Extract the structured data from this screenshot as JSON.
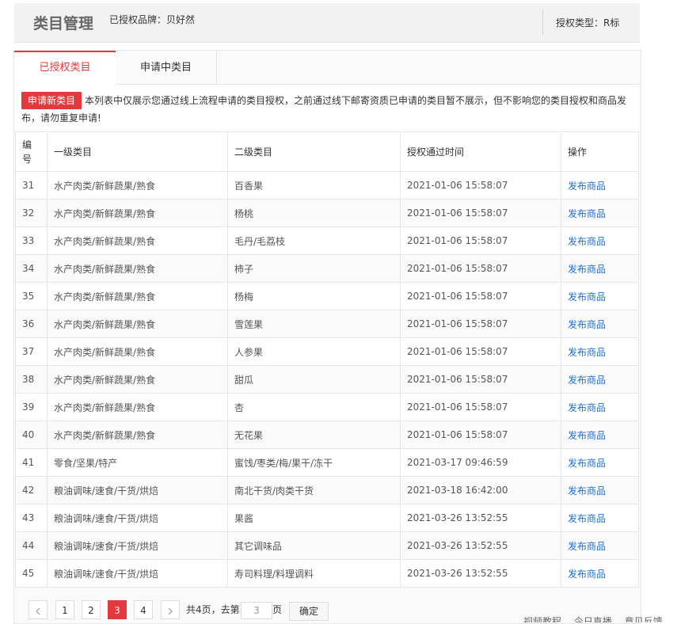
{
  "header": {
    "title": "类目管理",
    "brand_text": "已授权品牌：贝好然",
    "auth_type": "授权类型：R标"
  },
  "tabs": [
    {
      "label": "已授权类目",
      "active": true
    },
    {
      "label": "申请中类目",
      "active": false
    }
  ],
  "notice": {
    "apply_button": "申请新类目",
    "text": "本列表中仅展示您通过线上流程申请的类目授权，之前通过线下邮寄资质已申请的类目暂不展示，但不影响您的类目授权和商品发布，请勿重复申请!"
  },
  "table": {
    "headers": [
      "编号",
      "一级类目",
      "二级类目",
      "授权通过时间",
      "操作"
    ],
    "rows": [
      {
        "id": "31",
        "cat1": "水产肉类/新鲜蔬果/熟食",
        "cat2": "百香果",
        "time": "2021-01-06 15:58:07",
        "action": "发布商品"
      },
      {
        "id": "32",
        "cat1": "水产肉类/新鲜蔬果/熟食",
        "cat2": "杨桃",
        "time": "2021-01-06 15:58:07",
        "action": "发布商品"
      },
      {
        "id": "33",
        "cat1": "水产肉类/新鲜蔬果/熟食",
        "cat2": "毛丹/毛荔枝",
        "time": "2021-01-06 15:58:07",
        "action": "发布商品"
      },
      {
        "id": "34",
        "cat1": "水产肉类/新鲜蔬果/熟食",
        "cat2": "柿子",
        "time": "2021-01-06 15:58:07",
        "action": "发布商品"
      },
      {
        "id": "35",
        "cat1": "水产肉类/新鲜蔬果/熟食",
        "cat2": "杨梅",
        "time": "2021-01-06 15:58:07",
        "action": "发布商品"
      },
      {
        "id": "36",
        "cat1": "水产肉类/新鲜蔬果/熟食",
        "cat2": "雪莲果",
        "time": "2021-01-06 15:58:07",
        "action": "发布商品"
      },
      {
        "id": "37",
        "cat1": "水产肉类/新鲜蔬果/熟食",
        "cat2": "人参果",
        "time": "2021-01-06 15:58:07",
        "action": "发布商品"
      },
      {
        "id": "38",
        "cat1": "水产肉类/新鲜蔬果/熟食",
        "cat2": "甜瓜",
        "time": "2021-01-06 15:58:07",
        "action": "发布商品"
      },
      {
        "id": "39",
        "cat1": "水产肉类/新鲜蔬果/熟食",
        "cat2": "杏",
        "time": "2021-01-06 15:58:07",
        "action": "发布商品"
      },
      {
        "id": "40",
        "cat1": "水产肉类/新鲜蔬果/熟食",
        "cat2": "无花果",
        "time": "2021-01-06 15:58:07",
        "action": "发布商品"
      },
      {
        "id": "41",
        "cat1": "零食/坚果/特产",
        "cat2": "蜜饯/枣类/梅/果干/冻干",
        "time": "2021-03-17 09:46:59",
        "action": "发布商品"
      },
      {
        "id": "42",
        "cat1": "粮油调味/速食/干货/烘焙",
        "cat2": "南北干货/肉类干货",
        "time": "2021-03-18 16:42:00",
        "action": "发布商品"
      },
      {
        "id": "43",
        "cat1": "粮油调味/速食/干货/烘焙",
        "cat2": "果酱",
        "time": "2021-03-26 13:52:55",
        "action": "发布商品"
      },
      {
        "id": "44",
        "cat1": "粮油调味/速食/干货/烘焙",
        "cat2": "其它调味品",
        "time": "2021-03-26 13:52:55",
        "action": "发布商品"
      },
      {
        "id": "45",
        "cat1": "粮油调味/速食/干货/烘焙",
        "cat2": "寿司料理/料理调料",
        "time": "2021-03-26 13:52:55",
        "action": "发布商品"
      }
    ]
  },
  "pagination": {
    "prev_icon": "chevron-left-icon",
    "next_icon": "chevron-right-icon",
    "pages": [
      "1",
      "2",
      "3",
      "4"
    ],
    "current": "3",
    "total_text": "共4页，去第",
    "input_value": "3",
    "page_suffix": "页",
    "confirm_label": "确定"
  },
  "floating_bar": [
    "视频教程",
    "今日直播",
    "意见反馈"
  ],
  "colors": {
    "accent": "#e4393c",
    "link": "#1c6fd6",
    "header_bg": "#f2f2f2"
  }
}
